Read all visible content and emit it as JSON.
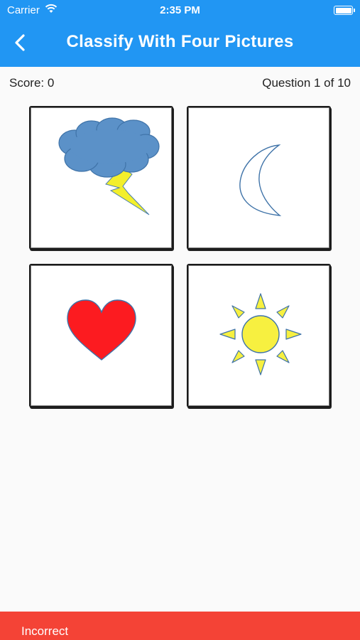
{
  "status_bar": {
    "carrier": "Carrier",
    "time": "2:35 PM",
    "wifi_icon": "wifi-icon",
    "battery_icon": "battery-icon"
  },
  "header": {
    "title": "Classify With Four Pictures",
    "back_icon": "chevron-left-icon",
    "color": "#2196f3"
  },
  "info": {
    "score": "Score: 0",
    "question": "Question 1 of 10"
  },
  "tiles": [
    {
      "picture": "storm-cloud-icon"
    },
    {
      "picture": "crescent-moon-icon"
    },
    {
      "picture": "heart-icon"
    },
    {
      "picture": "sun-icon"
    }
  ],
  "feedback": {
    "text": "Incorrect",
    "color": "#f44336"
  }
}
